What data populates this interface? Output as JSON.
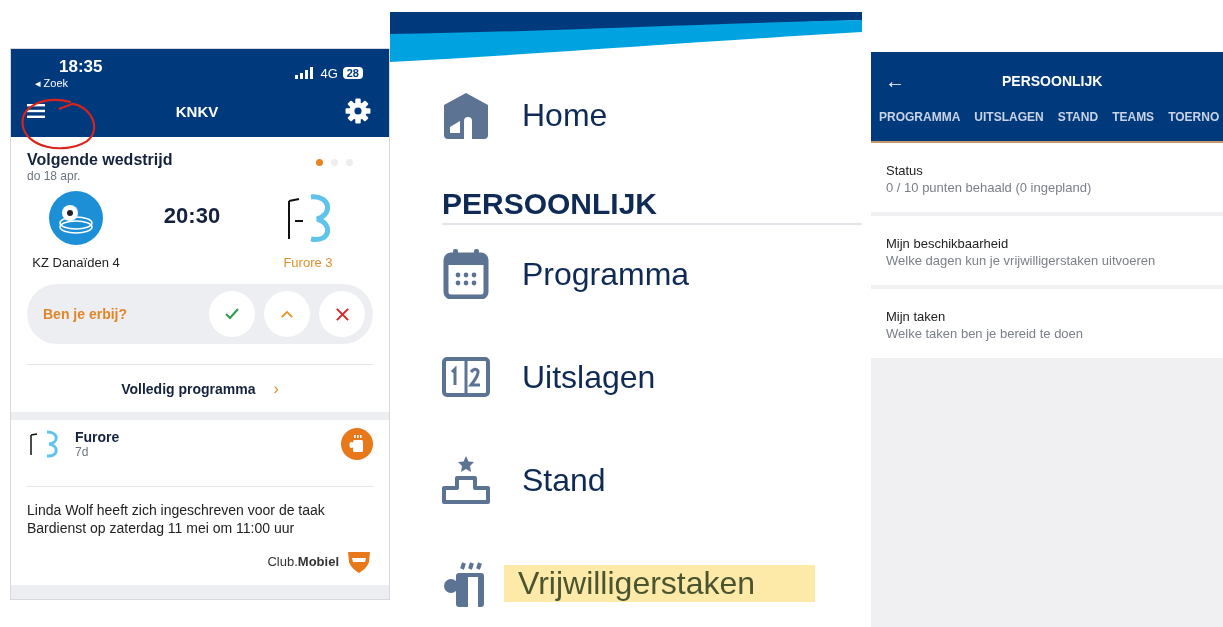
{
  "home_screen": {
    "status_bar": {
      "time": "18:35",
      "back_label": "◂ Zoek",
      "network": "4G",
      "battery": "28"
    },
    "header": {
      "title": "KNKV"
    },
    "next_match": {
      "title": "Volgende wedstrijd",
      "date": "do 18 apr.",
      "pager": [
        {
          "selected": true
        },
        {
          "selected": false
        },
        {
          "selected": false
        }
      ],
      "home_team": "KZ Danaïden 4",
      "time": "20:30",
      "away_team": "Furore 3",
      "question": "Ben je erbij?",
      "answers": [
        {
          "kind": "yes",
          "selected": false
        },
        {
          "kind": "maybe",
          "selected": false
        },
        {
          "kind": "no",
          "selected": false
        }
      ],
      "link": "Volledig programma",
      "link_arrow": "›"
    },
    "post": {
      "club": "Furore",
      "age": "7d",
      "message": "Linda Wolf heeft zich ingeschreven voor de taak Bardienst op zaterdag 11 mei om 11:00 uur",
      "brand": "Club.**Mobiel**"
    }
  },
  "menu": {
    "items": [
      {
        "kind": "home",
        "label": "Home",
        "highlighted": false
      }
    ],
    "section": "PERSOONLIJK",
    "section_items": [
      {
        "kind": "calendar",
        "label": "Programma",
        "highlighted": false
      },
      {
        "kind": "scores",
        "label": "Uitslagen",
        "highlighted": false
      },
      {
        "kind": "ranking",
        "label": "Stand",
        "highlighted": false
      },
      {
        "kind": "volunteer",
        "label": "Vrijwilligerstaken",
        "highlighted": true
      }
    ]
  },
  "personal_screen": {
    "title": "PERSOONLIJK",
    "back": "←",
    "tabs": [
      {
        "label": "PROGRAMMA",
        "selected": false
      },
      {
        "label": "UITSLAGEN",
        "selected": false
      },
      {
        "label": "STAND",
        "selected": false
      },
      {
        "label": "TEAMS",
        "selected": false
      },
      {
        "label": "TOERNO",
        "selected": false
      }
    ],
    "rows": [
      {
        "title": "Status",
        "subtitle": "0 / 10 punten behaald (0 ingepland)"
      },
      {
        "title": "Mijn beschikbaarheid",
        "subtitle": "Welke dagen kun je vrijwilligerstaken uitvoeren"
      },
      {
        "title": "Mijn taken",
        "subtitle": "Welke taken ben je bereid te doen"
      }
    ]
  }
}
